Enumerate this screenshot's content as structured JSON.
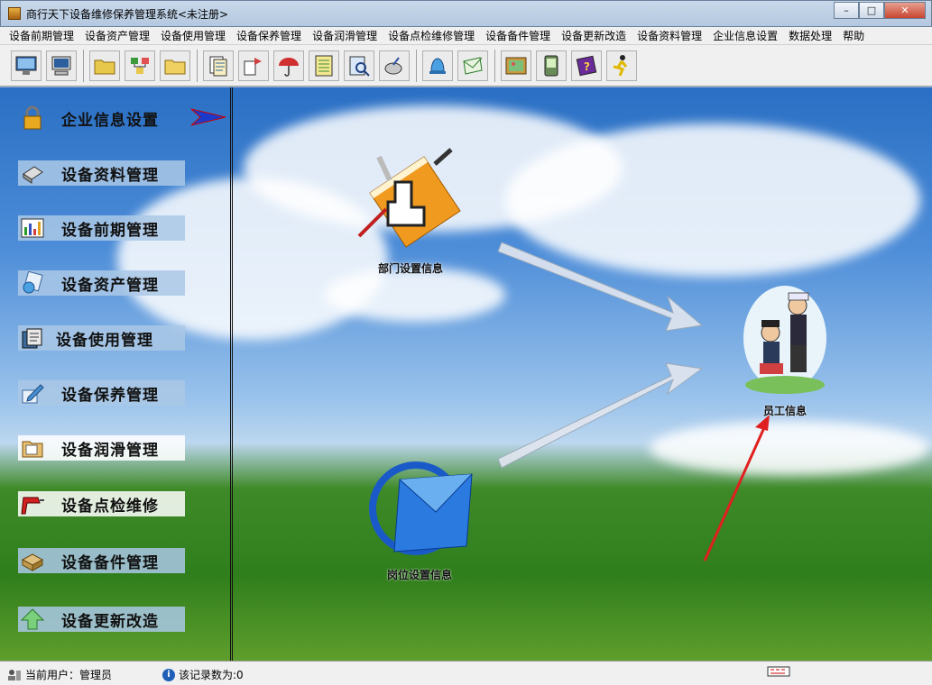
{
  "window": {
    "title": "商行天下设备维修保养管理系统<未注册>",
    "buttons": [
      "–",
      "□",
      "✕"
    ]
  },
  "menu": [
    "设备前期管理",
    "设备资产管理",
    "设备使用管理",
    "设备保养管理",
    "设备润滑管理",
    "设备点检维修管理",
    "设备备件管理",
    "设备更新改造",
    "设备资料管理",
    "企业信息设置",
    "数据处理",
    "帮助"
  ],
  "toolbar": {
    "icons": [
      "monitor-icon",
      "computer-icon",
      "folder-icon",
      "network-icon",
      "folder-open-icon",
      "document-stack-icon",
      "transfer-icon",
      "umbrella-icon",
      "notebook-icon",
      "magnifier-doc-icon",
      "search-bowl-icon",
      "bell-icon",
      "envelope-icon",
      "picture-icon",
      "pda-icon",
      "help-book-icon",
      "runner-icon"
    ]
  },
  "sidebar": {
    "items": [
      {
        "label": "企业信息设置",
        "icon": "lock-icon",
        "active": true
      },
      {
        "label": "设备资料管理",
        "icon": "book-icon"
      },
      {
        "label": "设备前期管理",
        "icon": "chart-icon"
      },
      {
        "label": "设备资产管理",
        "icon": "asset-icon"
      },
      {
        "label": "设备使用管理",
        "icon": "files-icon"
      },
      {
        "label": "设备保养管理",
        "icon": "edit-icon"
      },
      {
        "label": "设备润滑管理",
        "icon": "folder-icon"
      },
      {
        "label": "设备点检维修",
        "icon": "drill-icon"
      },
      {
        "label": "设备备件管理",
        "icon": "box-icon"
      },
      {
        "label": "设备更新改造",
        "icon": "up-arrow-icon"
      }
    ]
  },
  "nodes": {
    "dept": "部门设置信息",
    "employee": "员工信息",
    "position": "岗位设置信息"
  },
  "status": {
    "user": "当前用户：管理员",
    "records": "该记录数为:0"
  }
}
